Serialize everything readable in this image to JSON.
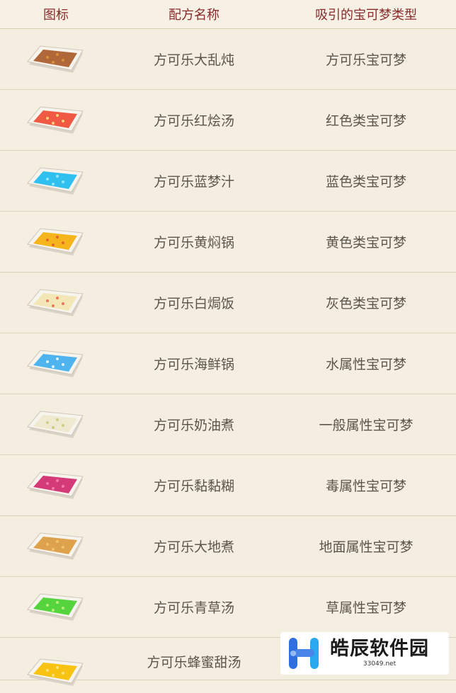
{
  "header": {
    "icon_col": "图标",
    "recipe_col": "配方名称",
    "attract_col": "吸引的宝可梦类型"
  },
  "rows": [
    {
      "recipe": "方可乐大乱炖",
      "attract": "方可乐宝可梦",
      "icon": "brown-dish-icon",
      "color": "#b0683a",
      "accent": "#d9903a"
    },
    {
      "recipe": "方可乐红烩汤",
      "attract": "红色类宝可梦",
      "icon": "red-dish-icon",
      "color": "#f05a44",
      "accent": "#ffd07a"
    },
    {
      "recipe": "方可乐蓝梦汁",
      "attract": "蓝色类宝可梦",
      "icon": "blue-dish-icon",
      "color": "#2fc0f0",
      "accent": "#8fe6ff"
    },
    {
      "recipe": "方可乐黄焖锅",
      "attract": "黄色类宝可梦",
      "icon": "yellow-dish-icon",
      "color": "#f6b51d",
      "accent": "#e26a2a"
    },
    {
      "recipe": "方可乐白焗饭",
      "attract": "灰色类宝可梦",
      "icon": "cream-dish-icon",
      "color": "#f3e7b8",
      "accent": "#e87a5a"
    },
    {
      "recipe": "方可乐海鲜锅",
      "attract": "水属性宝可梦",
      "icon": "seafood-dish-icon",
      "color": "#4fb4ee",
      "accent": "#d8f2ff"
    },
    {
      "recipe": "方可乐奶油煮",
      "attract": "一般属性宝可梦",
      "icon": "milk-dish-icon",
      "color": "#efe9cf",
      "accent": "#c9d08a"
    },
    {
      "recipe": "方可乐黏黏糊",
      "attract": "毒属性宝可梦",
      "icon": "poison-dish-icon",
      "color": "#d53a78",
      "accent": "#f57aa8"
    },
    {
      "recipe": "方可乐大地煮",
      "attract": "地面属性宝可梦",
      "icon": "earth-dish-icon",
      "color": "#dfa24c",
      "accent": "#f0c06a"
    },
    {
      "recipe": "方可乐青草汤",
      "attract": "草属性宝可梦",
      "icon": "grass-dish-icon",
      "color": "#55d43e",
      "accent": "#b6f07a"
    },
    {
      "recipe": "方可乐蜂蜜甜汤",
      "attract": "",
      "icon": "honey-dish-icon",
      "color": "#f8c312",
      "accent": "#ffe27a"
    }
  ],
  "watermark": {
    "title": "皓辰软件园",
    "url": "33049.net",
    "logo": "watermark-logo-icon",
    "logo_color": "#2f6fe0"
  }
}
